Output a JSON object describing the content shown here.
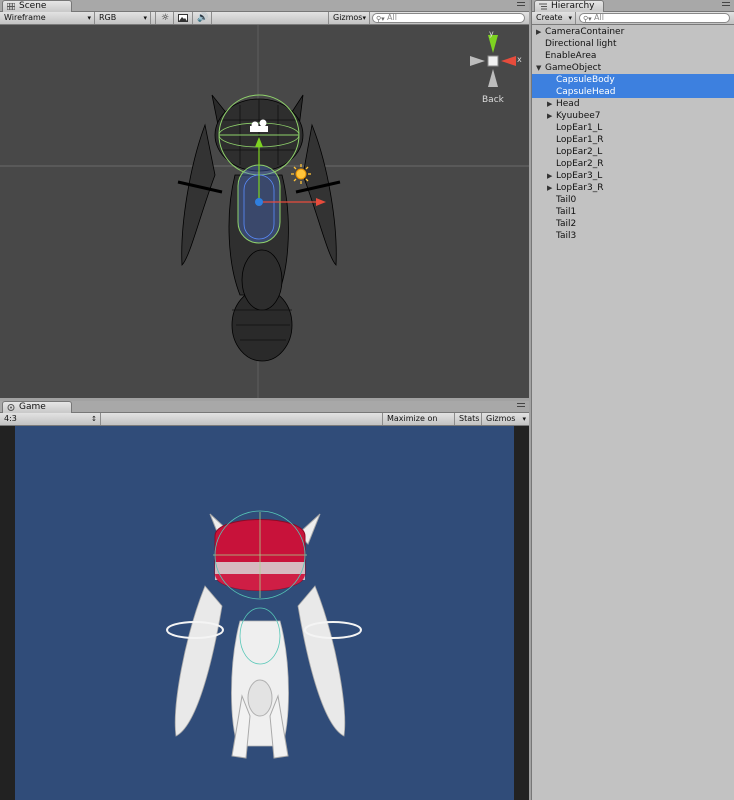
{
  "scene": {
    "tab_label": "Scene",
    "render_mode": "Wireframe",
    "channel": "RGB",
    "gizmos_label": "Gizmos",
    "search_placeholder": "All",
    "view_label": "Back",
    "axis_y": "y",
    "axis_x": "x",
    "icons": [
      "light-toggle-icon",
      "image-toggle-icon",
      "audio-toggle-icon"
    ]
  },
  "hierarchy": {
    "tab_label": "Hierarchy",
    "create_label": "Create",
    "search_placeholder": "All",
    "items": [
      {
        "label": "CameraContainer",
        "depth": 0,
        "expand": "collapsed",
        "selected": false
      },
      {
        "label": "Directional light",
        "depth": 0,
        "expand": "none",
        "selected": false
      },
      {
        "label": "EnableArea",
        "depth": 0,
        "expand": "none",
        "selected": false
      },
      {
        "label": "GameObject",
        "depth": 0,
        "expand": "expanded",
        "selected": false
      },
      {
        "label": "CapsuleBody",
        "depth": 1,
        "expand": "none",
        "selected": true
      },
      {
        "label": "CapsuleHead",
        "depth": 1,
        "expand": "none",
        "selected": true
      },
      {
        "label": "Head",
        "depth": 1,
        "expand": "collapsed",
        "selected": false
      },
      {
        "label": "Kyuubee7",
        "depth": 1,
        "expand": "collapsed",
        "selected": false
      },
      {
        "label": "LopEar1_L",
        "depth": 1,
        "expand": "none",
        "selected": false
      },
      {
        "label": "LopEar1_R",
        "depth": 1,
        "expand": "none",
        "selected": false
      },
      {
        "label": "LopEar2_L",
        "depth": 1,
        "expand": "none",
        "selected": false
      },
      {
        "label": "LopEar2_R",
        "depth": 1,
        "expand": "none",
        "selected": false
      },
      {
        "label": "LopEar3_L",
        "depth": 1,
        "expand": "collapsed",
        "selected": false
      },
      {
        "label": "LopEar3_R",
        "depth": 1,
        "expand": "collapsed",
        "selected": false
      },
      {
        "label": "Tail0",
        "depth": 1,
        "expand": "none",
        "selected": false
      },
      {
        "label": "Tail1",
        "depth": 1,
        "expand": "none",
        "selected": false
      },
      {
        "label": "Tail2",
        "depth": 1,
        "expand": "none",
        "selected": false
      },
      {
        "label": "Tail3",
        "depth": 1,
        "expand": "none",
        "selected": false
      }
    ]
  },
  "game": {
    "tab_label": "Game",
    "aspect": "4:3",
    "maximize_label": "Maximize on Play",
    "stats_label": "Stats",
    "gizmos_label": "Gizmos"
  },
  "colors": {
    "scene_bg": "#484848",
    "game_bg": "#304c79",
    "selection": "#3d80df",
    "capsule_red": "#c8123a"
  }
}
